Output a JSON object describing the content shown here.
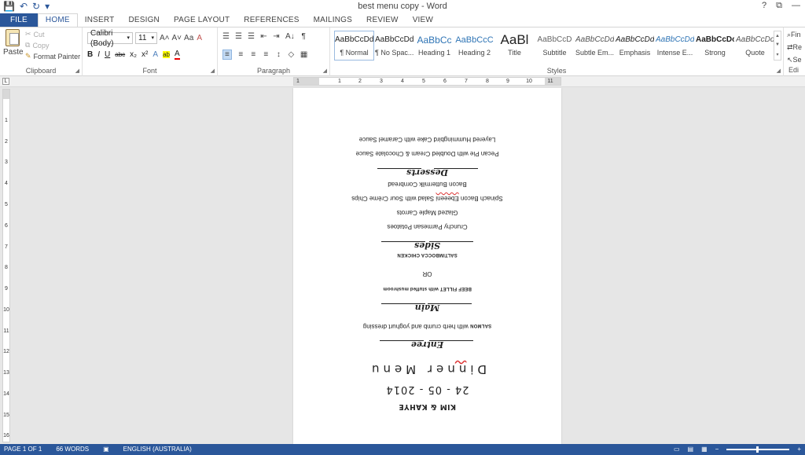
{
  "window": {
    "title": "best menu copy - Word",
    "controls": {
      "help": "?",
      "restore": "⧉",
      "minimize": "—"
    }
  },
  "quick_access": {
    "save_icon": "💾",
    "undo_icon": "↶",
    "redo_icon": "↻",
    "customize_icon": "▾"
  },
  "tabs": [
    {
      "label": "FILE"
    },
    {
      "label": "HOME"
    },
    {
      "label": "INSERT"
    },
    {
      "label": "DESIGN"
    },
    {
      "label": "PAGE LAYOUT"
    },
    {
      "label": "REFERENCES"
    },
    {
      "label": "MAILINGS"
    },
    {
      "label": "REVIEW"
    },
    {
      "label": "VIEW"
    }
  ],
  "ribbon": {
    "clipboard": {
      "label": "Clipboard",
      "paste": "Paste",
      "cut": "Cut",
      "copy": "Copy",
      "format_painter": "Format Painter"
    },
    "font": {
      "label": "Font",
      "font_name": "Calibri (Body)",
      "font_size": "11",
      "grow": "A˄",
      "shrink": "A˅",
      "change_case": "Aa",
      "clear_format": "A",
      "bold": "B",
      "italic": "I",
      "underline": "U",
      "strike": "abc",
      "subscript": "x₂",
      "superscript": "x²",
      "effects": "A",
      "highlight": "ab",
      "font_color": "A"
    },
    "paragraph": {
      "label": "Paragraph",
      "bullets": "☰",
      "numbering": "☰",
      "multilevel": "☰",
      "decrease_indent": "⇤",
      "increase_indent": "⇥",
      "sort": "A↓",
      "show_marks": "¶",
      "align_left": "≡",
      "align_center": "≡",
      "align_right": "≡",
      "justify": "≡",
      "line_spacing": "↕",
      "shading": "◇",
      "borders": "▦"
    },
    "styles": {
      "label": "Styles",
      "items": [
        {
          "sample": "AaBbCcDd",
          "name": "¶ Normal"
        },
        {
          "sample": "AaBbCcDd",
          "name": "¶ No Spac..."
        },
        {
          "sample": "AaBbCc",
          "name": "Heading 1"
        },
        {
          "sample": "AaBbCcC",
          "name": "Heading 2"
        },
        {
          "sample": "AaBl",
          "name": "Title"
        },
        {
          "sample": "AaBbCcD",
          "name": "Subtitle"
        },
        {
          "sample": "AaBbCcDd",
          "name": "Subtle Em..."
        },
        {
          "sample": "AaBbCcDd",
          "name": "Emphasis"
        },
        {
          "sample": "AaBbCcDd",
          "name": "Intense E..."
        },
        {
          "sample": "AaBbCcDc",
          "name": "Strong"
        },
        {
          "sample": "AaBbCcDd",
          "name": "Quote"
        }
      ]
    },
    "editing": {
      "label": "Edi",
      "find": "Fin",
      "replace": "Re",
      "select": "Se"
    }
  },
  "ruler": {
    "horizontal_numbers": [
      "1",
      "1",
      "2",
      "3",
      "4",
      "5",
      "6",
      "7",
      "8",
      "9",
      "10",
      "11"
    ],
    "vertical_numbers": [
      "1",
      "2",
      "3",
      "4",
      "5",
      "6",
      "7",
      "8",
      "9",
      "10",
      "11",
      "12",
      "13",
      "14",
      "15",
      "16"
    ],
    "corner_icon": "L"
  },
  "document": {
    "names": "KIM & KAHYE",
    "date": "24 - 05 - 2014",
    "title_prefix": "Di",
    "title_squiggle": "n",
    "title_suffix": "ner Menu",
    "entree_heading": "Entree",
    "salmon_bold": "SALMON",
    "salmon_rest": " with herb crumb and yoghurt dressing",
    "main_heading": "Main",
    "beef": "BEEF FILLET with stuffed mushroom",
    "or": "OR",
    "chicken": "SALTIMBOCCA CHICKEN",
    "sides_heading": "Sides",
    "side_1": "Crunchy Parmesan Potatoes",
    "side_2": "Glazed Maple Carrots",
    "side_3_prefix": "Spinach Bacon ",
    "side_3_squiggle": "Ebeeeni",
    "side_3_suffix": " Salad with Sour Crème Chips",
    "side_4": "Bacon Buttermilk Cornbread",
    "desserts_heading": "Desserts",
    "dessert_1": "Pecan Pie with Doubled Cream & Chocolate Sauce",
    "dessert_2": "Layered Hummingbird Cake with Caramel Sauce"
  },
  "status": {
    "page": "PAGE 1 OF 1",
    "words": "66 WORDS",
    "proof_icon": "▣",
    "language": "ENGLISH (AUSTRALIA)",
    "zoom_minus": "−",
    "zoom_plus": "+"
  },
  "colors": {
    "accent": "#2b579a",
    "page": "#ffffff",
    "workspace": "#e6e6e6"
  }
}
